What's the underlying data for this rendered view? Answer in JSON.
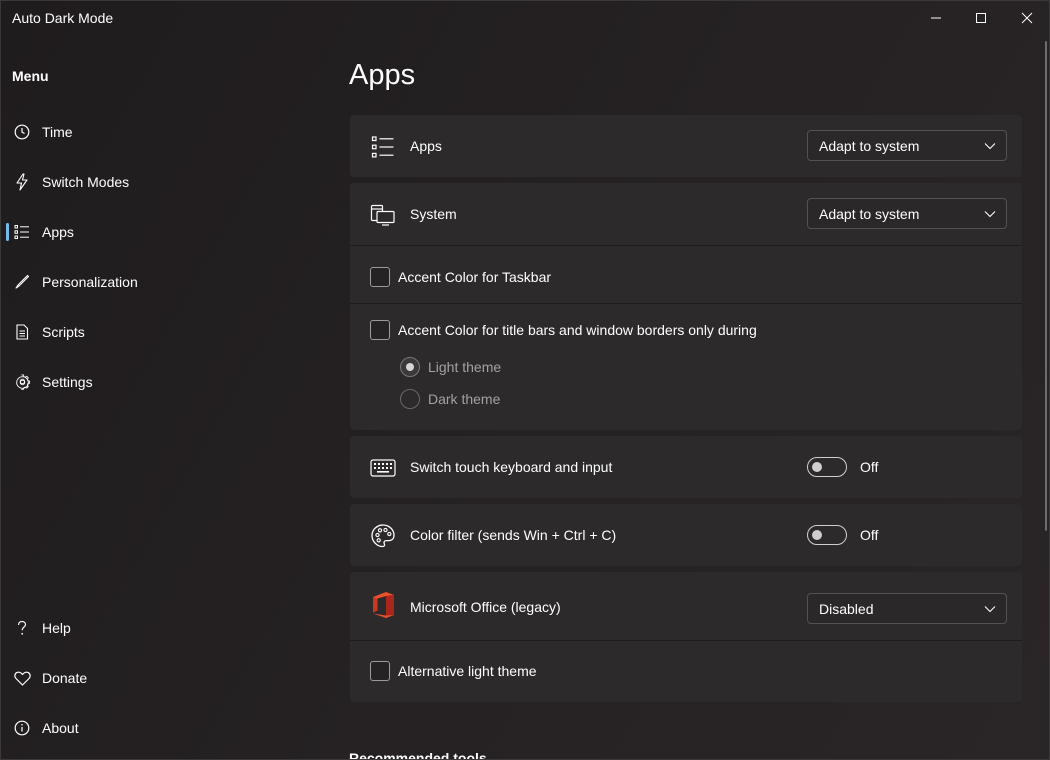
{
  "window": {
    "title": "Auto Dark Mode"
  },
  "sidebar": {
    "menu_label": "Menu",
    "items": [
      {
        "label": "Time",
        "icon": "clock-icon"
      },
      {
        "label": "Switch Modes",
        "icon": "lightning-icon"
      },
      {
        "label": "Apps",
        "icon": "bulleted-list-icon",
        "active": true
      },
      {
        "label": "Personalization",
        "icon": "pen-icon"
      },
      {
        "label": "Scripts",
        "icon": "document-icon"
      },
      {
        "label": "Settings",
        "icon": "gear-icon"
      }
    ],
    "footer_items": [
      {
        "label": "Help",
        "icon": "question-icon"
      },
      {
        "label": "Donate",
        "icon": "heart-icon"
      },
      {
        "label": "About",
        "icon": "info-icon"
      }
    ]
  },
  "main": {
    "page_title": "Apps",
    "apps_row": {
      "label": "Apps",
      "dropdown_value": "Adapt to system"
    },
    "system_row": {
      "label": "System",
      "dropdown_value": "Adapt to system"
    },
    "accent_taskbar": {
      "label": "Accent Color for Taskbar",
      "checked": false
    },
    "accent_titlebars": {
      "label": "Accent Color for title bars and window borders only during",
      "checked": false,
      "options": [
        {
          "label": "Light theme",
          "selected": true
        },
        {
          "label": "Dark theme",
          "selected": false
        }
      ]
    },
    "touch_keyboard": {
      "label": "Switch touch keyboard and input",
      "state": "Off"
    },
    "color_filter": {
      "label": "Color filter (sends Win + Ctrl + C)",
      "state": "Off"
    },
    "office": {
      "label": "Microsoft Office (legacy)",
      "dropdown_value": "Disabled"
    },
    "alt_light_theme": {
      "label": "Alternative light theme",
      "checked": false
    },
    "recommended_tools": "Recommended tools"
  },
  "colors": {
    "accent": "#76b9ed",
    "card_bg": "#2d2a2c",
    "window_bg": "#221f21"
  }
}
